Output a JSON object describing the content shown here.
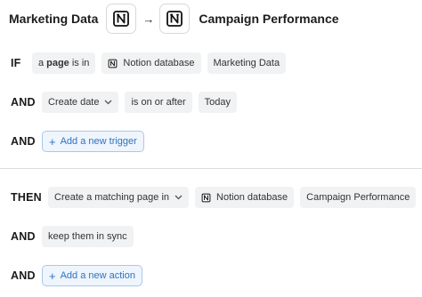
{
  "header": {
    "source_name": "Marketing Data",
    "arrow": "→",
    "target_name": "Campaign Performance",
    "source_icon": "notion-icon",
    "target_icon": "notion-icon"
  },
  "trigger_rows": [
    {
      "keyword": "IF",
      "chips": {
        "subject_prefix": "a",
        "subject_bold": "page",
        "subject_suffix": "is in",
        "source_label": "Notion database",
        "value": "Marketing Data"
      }
    },
    {
      "keyword": "AND",
      "chips": {
        "field": "Create date",
        "operator": "is on or after",
        "value": "Today"
      }
    },
    {
      "keyword": "AND",
      "add_label": "Add a new trigger"
    }
  ],
  "action_rows": [
    {
      "keyword": "THEN",
      "chips": {
        "action": "Create a matching page in",
        "target_label": "Notion database",
        "value": "Campaign Performance"
      }
    },
    {
      "keyword": "AND",
      "chips": {
        "option": "keep them in sync"
      }
    },
    {
      "keyword": "AND",
      "add_label": "Add a new action"
    }
  ],
  "colors": {
    "chip_bg": "#f1f2f3",
    "add_button_bg": "#eef5fc",
    "add_button_border": "#a9c8ea",
    "add_button_text": "#2f72c4"
  }
}
